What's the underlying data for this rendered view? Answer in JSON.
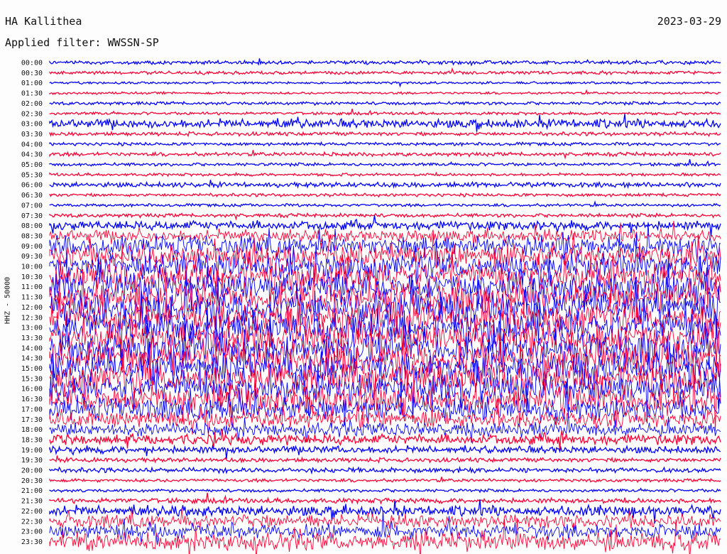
{
  "header": {
    "station": "HA Kallithea",
    "date": "2023-03-29",
    "filter_label": "Applied filter: WWSSN-SP"
  },
  "colors": {
    "odd_rows": "#0000ff",
    "even_rows": "#ff0033",
    "text": "#111111"
  },
  "chart_data": {
    "type": "line",
    "title": "HA Kallithea",
    "xlabel": "",
    "ylabel": "HHZ - 50000",
    "y_tick_labels": [
      "00:00",
      "00:30",
      "01:00",
      "01:30",
      "02:00",
      "02:30",
      "03:00",
      "03:30",
      "04:00",
      "04:30",
      "05:00",
      "05:30",
      "06:00",
      "06:30",
      "07:00",
      "07:30",
      "08:00",
      "08:30",
      "09:00",
      "09:30",
      "10:00",
      "10:30",
      "11:00",
      "11:30",
      "12:00",
      "12:30",
      "13:00",
      "13:30",
      "14:00",
      "14:30",
      "15:00",
      "15:30",
      "16:00",
      "16:30",
      "17:00",
      "17:30",
      "18:00",
      "18:30",
      "19:00",
      "19:30",
      "20:00",
      "20:30",
      "21:00",
      "21:30",
      "22:00",
      "22:30",
      "23:00",
      "23:30"
    ],
    "row_colors": [
      "#0000ff",
      "#ff0033"
    ],
    "relative_activity": [
      0.08,
      0.06,
      0.03,
      0.03,
      0.06,
      0.05,
      0.25,
      0.08,
      0.06,
      0.08,
      0.06,
      0.05,
      0.12,
      0.06,
      0.05,
      0.08,
      0.25,
      0.35,
      0.6,
      0.7,
      0.8,
      0.85,
      0.9,
      0.9,
      0.95,
      0.95,
      0.95,
      0.95,
      0.95,
      0.95,
      0.95,
      0.95,
      0.9,
      0.85,
      0.7,
      0.55,
      0.4,
      0.3,
      0.2,
      0.1,
      0.12,
      0.06,
      0.06,
      0.12,
      0.3,
      0.4,
      0.45,
      0.55
    ],
    "grid": false,
    "legend": "none"
  }
}
